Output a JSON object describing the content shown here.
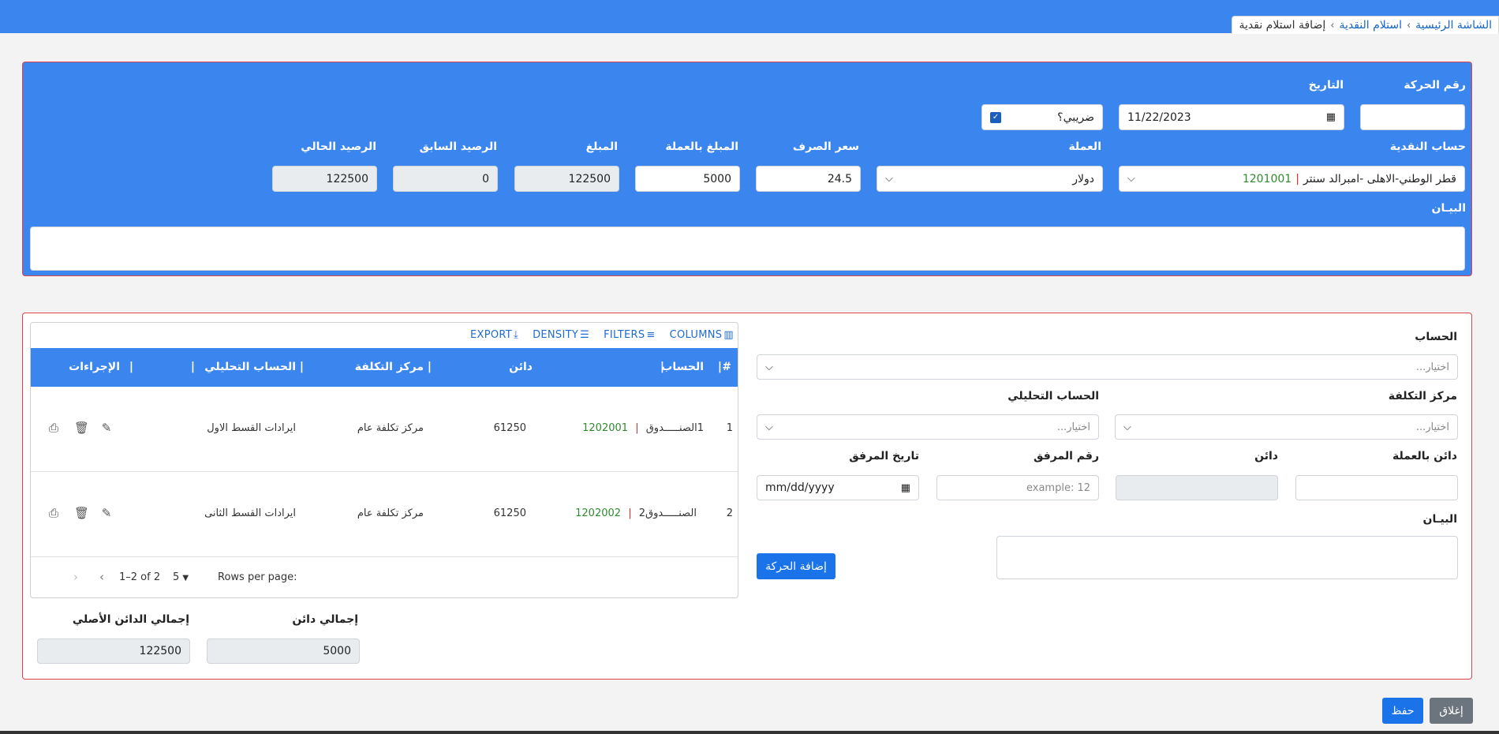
{
  "breadcrumb": {
    "home": "الشاشة الرئيسية",
    "section": "استلام النقدية",
    "current": "إضافة استلام نقدية"
  },
  "header_form": {
    "movement_no_label": "رقم الحركة",
    "movement_no_value": "",
    "date_label": "التاريخ",
    "date_value": "11/22/2023",
    "tax_label": "ضريبي؟",
    "tax_checked": true,
    "cash_account_label": "حساب النقدية",
    "cash_account_code": "1201001",
    "cash_account_name": "قطر الوطني-الاهلى -امبرالد سنتر",
    "currency_label": "العملة",
    "currency_value": "دولار",
    "exchange_rate_label": "سعر الصرف",
    "exchange_rate_value": "24.5",
    "amount_currency_label": "المبلغ بالعملة",
    "amount_currency_value": "5000",
    "amount_label": "المبلغ",
    "amount_value": "122500",
    "prev_balance_label": "الرصيد السابق",
    "prev_balance_value": "0",
    "current_balance_label": "الرصيد الحالي",
    "current_balance_value": "122500",
    "description_label": "البيـان",
    "description_value": ""
  },
  "toolbar": {
    "columns": "COLUMNS",
    "filters": "FILTERS",
    "density": "DENSITY",
    "export": "EXPORT"
  },
  "table": {
    "headers": {
      "index": "#",
      "account": "الحساب",
      "credit": "دائن",
      "cost_center": "مركز التكلفة",
      "analytic": "الحساب التحليلي",
      "actions": "الإجراءات"
    },
    "rows": [
      {
        "index": "1",
        "code": "1202001",
        "account": "1الصنـــــدوق",
        "credit": "61250",
        "cost_center": "مركز تكلفة عام",
        "analytic": "ايرادات القسط الاول"
      },
      {
        "index": "2",
        "code": "1202002",
        "account": "الصنـــــدوق2",
        "credit": "61250",
        "cost_center": "مركز تكلفة عام",
        "analytic": "ايرادات القسط الثانى"
      }
    ]
  },
  "pagination": {
    "rows_per_page_label": "Rows per page:",
    "rows_per_page_value": "5",
    "range": "1–2 of 2"
  },
  "totals": {
    "total_credit_label": "إجمالي دائن",
    "total_credit_value": "5000",
    "total_original_label": "إجمالي الدائن الأصلي",
    "total_original_value": "122500"
  },
  "line_form": {
    "account_label": "الحساب",
    "account_placeholder": "اختيار...",
    "cost_center_label": "مركز التكلفة",
    "cost_center_placeholder": "اختيار...",
    "analytic_label": "الحساب التحليلي",
    "analytic_placeholder": "اختيار...",
    "credit_currency_label": "دائن بالعملة",
    "credit_label": "دائن",
    "attachment_no_label": "رقم المرفق",
    "attachment_no_placeholder": "example: 12",
    "attachment_date_label": "تاريخ المرفق",
    "attachment_date_placeholder": "mm/dd/yyyy",
    "description_label": "البيـان",
    "add_button": "إضافة الحركة"
  },
  "footer": {
    "close_button": "إغلاق",
    "save_button": "حفظ"
  },
  "colors": {
    "primary": "#3b86ee",
    "button_blue": "#1a73e8",
    "border_red": "#e0434b",
    "code_green": "#2e8b2e"
  }
}
